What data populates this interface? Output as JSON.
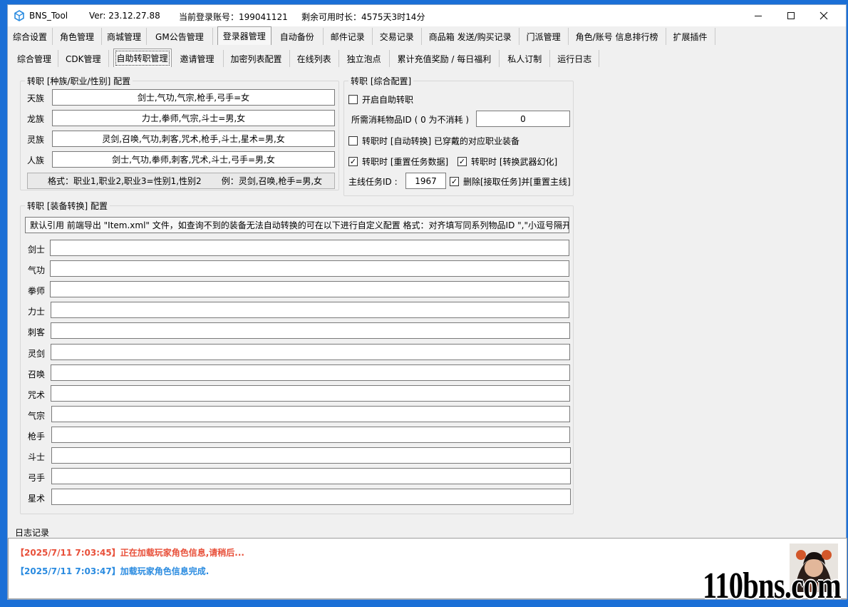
{
  "titlebar": {
    "app_name": "BNS_Tool",
    "version": "Ver:  23.12.27.88",
    "account": "当前登录账号：199041121",
    "remaining": "剩余可用时长：4575天3时14分"
  },
  "main_tabs": [
    "综合设置",
    "角色管理",
    "商城管理",
    "GM公告管理",
    "登录器管理",
    "自动备份",
    "邮件记录",
    "交易记录",
    "商品箱 发送/购买记录",
    "门派管理",
    "角色/账号 信息排行榜",
    "扩展插件"
  ],
  "sub_tabs": [
    "综合管理",
    "CDK管理",
    "自助转职管理",
    "邀请管理",
    "加密列表配置",
    "在线列表",
    "独立泡点",
    "累计充值奖励 / 每日福利",
    "私人订制",
    "运行日志"
  ],
  "race_group": {
    "title": "转职 [种族/职业/性别] 配置",
    "rows": [
      {
        "label": "天族",
        "value": "剑士,气功,气宗,枪手,弓手=女"
      },
      {
        "label": "龙族",
        "value": "力士,拳师,气宗,斗士=男,女"
      },
      {
        "label": "灵族",
        "value": "灵剑,召唤,气功,刺客,咒术,枪手,斗士,星术=男,女"
      },
      {
        "label": "人族",
        "value": "剑士,气功,拳师,刺客,咒术,斗士,弓手=男,女"
      }
    ],
    "format_text": "格式：职业1,职业2,职业3=性别1,性别2",
    "example_text": "例：灵剑,召唤,枪手=男,女"
  },
  "general_group": {
    "title": "转职 [综合配置]",
    "enable_label": "开启自助转职",
    "enable_checked": false,
    "consume_label": "所需消耗物品ID ( 0 为不消耗 )",
    "consume_value": "0",
    "auto_convert_label": "转职时 [自动转换] 已穿戴的对应职业装备",
    "auto_convert_checked": false,
    "reset_task_label": "转职时 [重置任务数据]",
    "reset_task_checked": true,
    "weapon_label": "转职时 [转换武器幻化]",
    "weapon_checked": true,
    "mainline_label": "主线任务ID :",
    "mainline_value": "1967",
    "delete_label": "删除[接取任务]并[重置主线]",
    "delete_checked": true
  },
  "equip_group": {
    "title": "转职 [装备转换] 配置",
    "info": "默认引用 前端导出 \"Item.xml\" 文件，如查询不到的装备无法自动转换的可在以下进行自定义配置 格式：对齐填写同系列物品ID \",\"小逗号隔开",
    "rows": [
      {
        "label": "剑士",
        "value": ""
      },
      {
        "label": "气功",
        "value": ""
      },
      {
        "label": "拳师",
        "value": ""
      },
      {
        "label": "力士",
        "value": ""
      },
      {
        "label": "刺客",
        "value": ""
      },
      {
        "label": "灵剑",
        "value": ""
      },
      {
        "label": "召唤",
        "value": ""
      },
      {
        "label": "咒术",
        "value": ""
      },
      {
        "label": "气宗",
        "value": ""
      },
      {
        "label": "枪手",
        "value": ""
      },
      {
        "label": "斗士",
        "value": ""
      },
      {
        "label": "弓手",
        "value": ""
      },
      {
        "label": "星术",
        "value": ""
      }
    ]
  },
  "log": {
    "title": "日志记录",
    "lines": [
      {
        "text": "【2025/7/11 7:03:45】正在加载玩家角色信息,请稍后...",
        "color": "#e8503a"
      },
      {
        "text": "【2025/7/11 7:03:47】加载玩家角色信息完成.",
        "color": "#2a8be0"
      }
    ]
  },
  "watermark": "110bns.com",
  "colors": {
    "accent": "#1b6fd6",
    "log_warn": "#e8503a",
    "log_ok": "#2a8be0"
  }
}
